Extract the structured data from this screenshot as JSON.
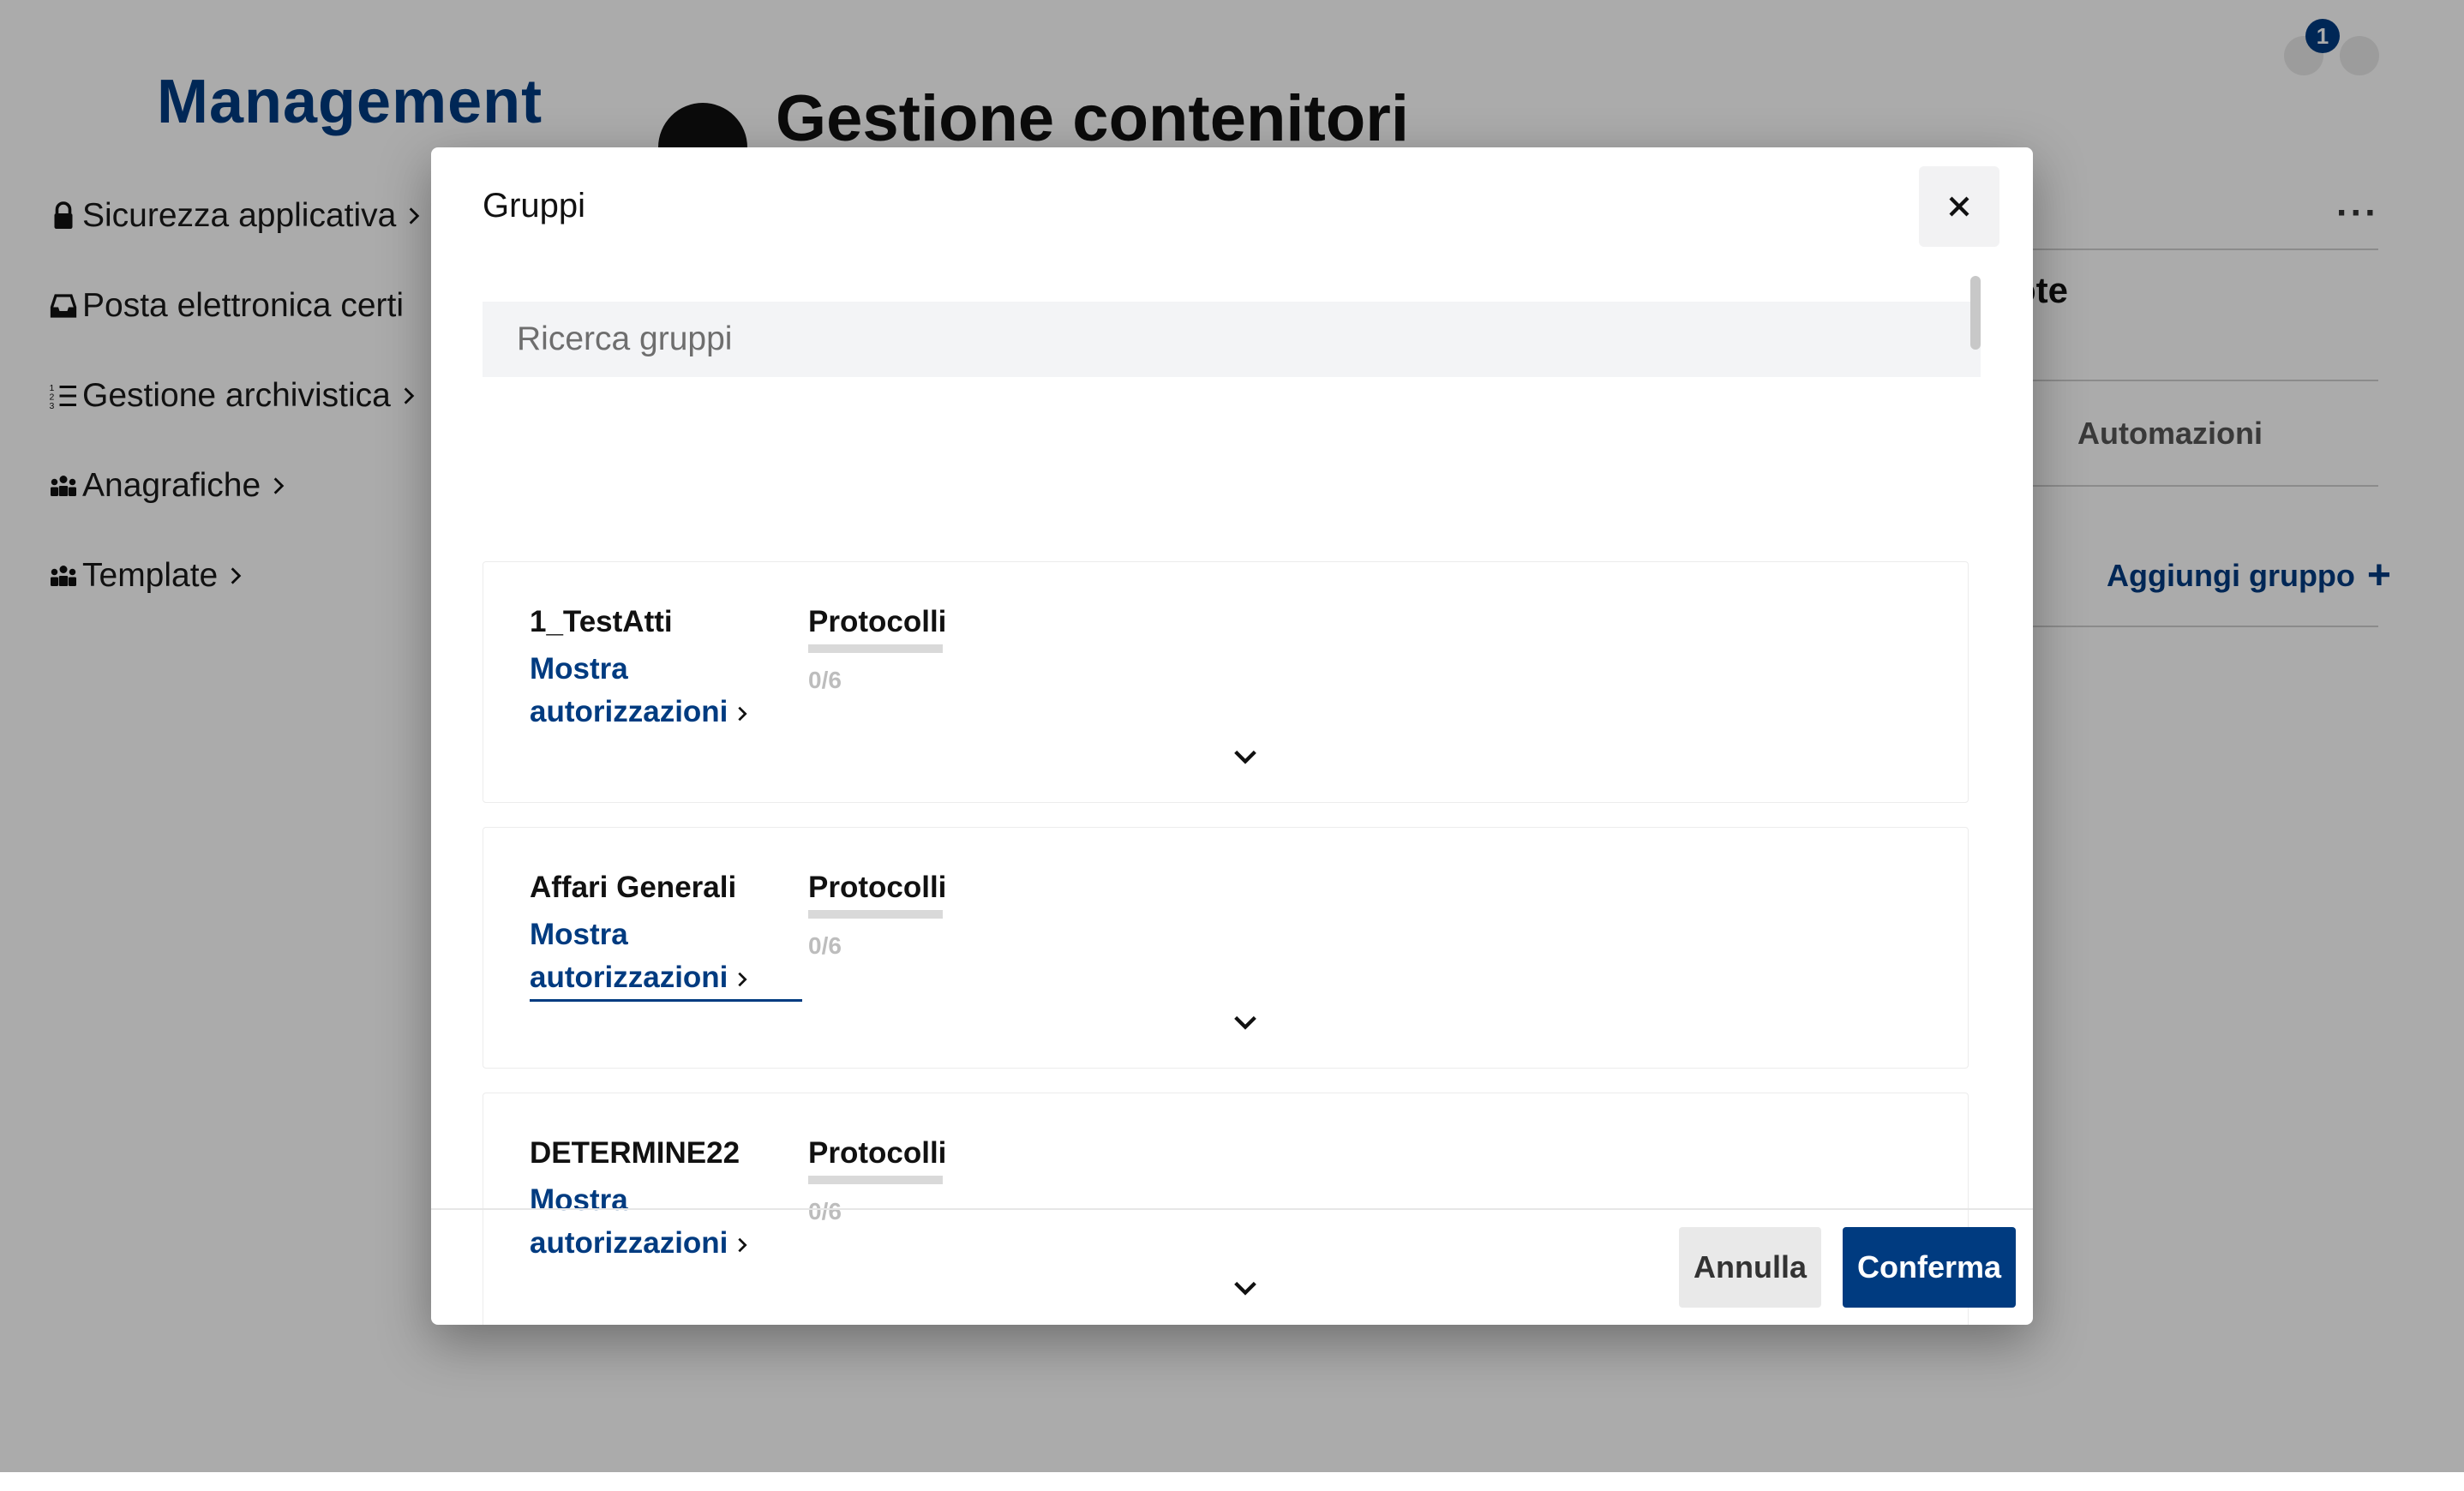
{
  "app": {
    "brand": "Management"
  },
  "sidebar": {
    "items": [
      {
        "label": "Sicurezza applicativa",
        "icon": "lock-icon"
      },
      {
        "label": "Posta elettronica certi",
        "icon": "inbox-icon"
      },
      {
        "label": "Gestione archivistica",
        "icon": "ordered-list-icon"
      },
      {
        "label": "Anagrafiche",
        "icon": "users-icon"
      },
      {
        "label": "Template",
        "icon": "users-icon"
      }
    ]
  },
  "header": {
    "title": "Gestione contenitori",
    "notification_count": "1"
  },
  "background": {
    "tab_partial": "ote",
    "tab_automations": "Automazioni",
    "add_group_label": "Aggiungi gruppo",
    "add_group_icon": "+"
  },
  "modal": {
    "title": "Gruppi",
    "search_placeholder": "Ricerca gruppi",
    "groups": [
      {
        "name": "1_TestAtti",
        "show_auth": "Mostra autorizzazioni",
        "category": "Protocolli",
        "progress_text": "0/6",
        "progress": 0
      },
      {
        "name": "Affari Generali",
        "show_auth": "Mostra autorizzazioni",
        "category": "Protocolli",
        "progress_text": "0/6",
        "progress": 0
      },
      {
        "name": "DETERMINE22",
        "show_auth": "Mostra autorizzazioni",
        "category": "Protocolli",
        "progress_text": "0/6",
        "progress": 0
      }
    ],
    "cancel_label": "Annulla",
    "confirm_label": "Conferma"
  },
  "colors": {
    "brand": "#003b80",
    "overlay": "rgba(0,0,0,0.33)"
  }
}
